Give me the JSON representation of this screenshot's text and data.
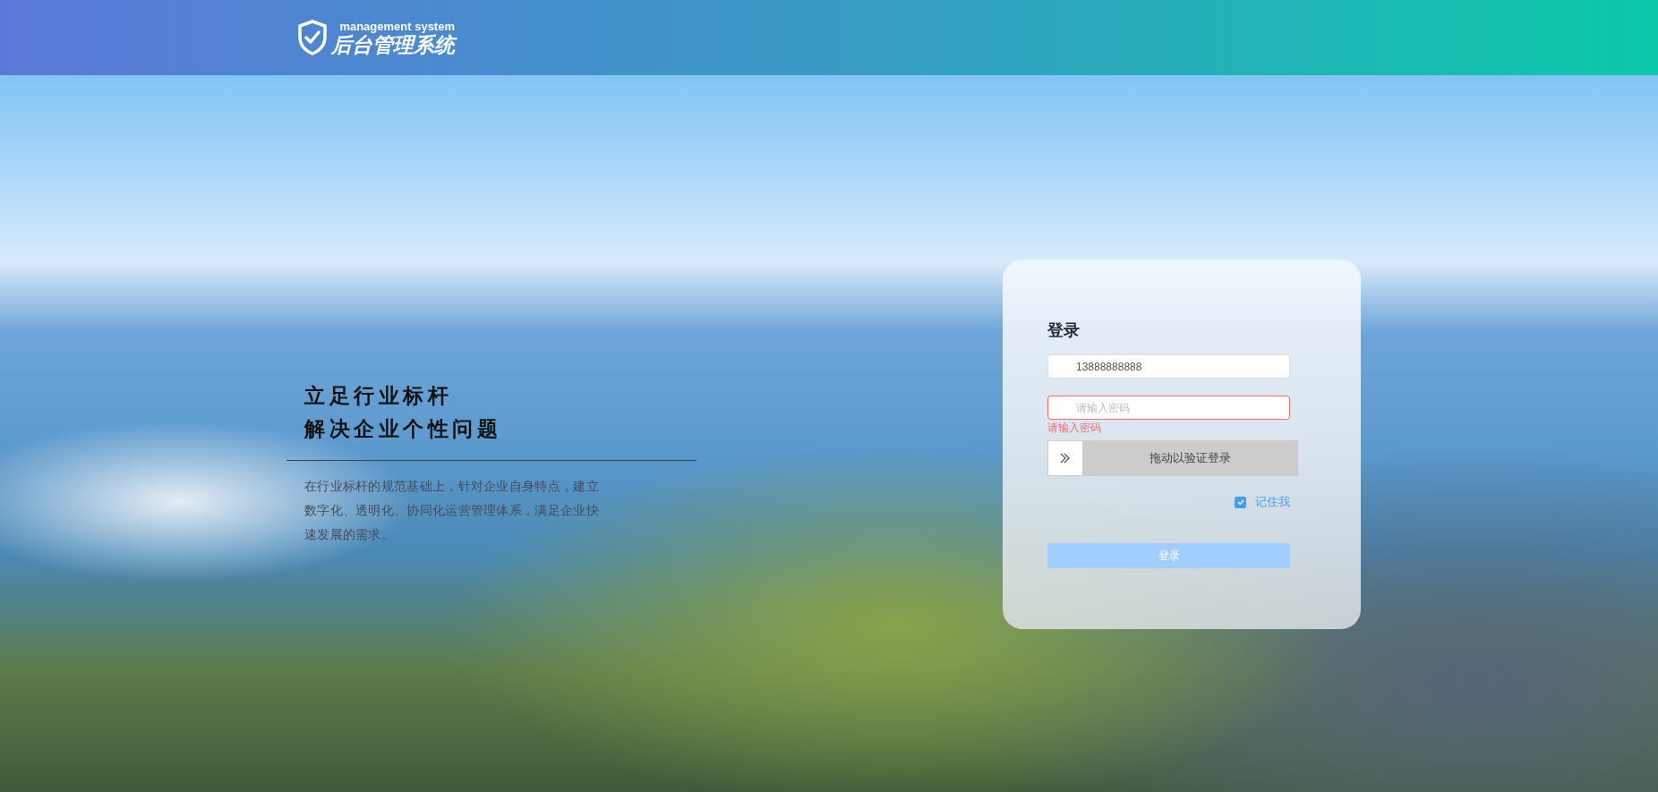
{
  "header": {
    "logo_subtitle": "management system",
    "logo_title": "后台管理系统"
  },
  "intro": {
    "headline": [
      "立足行业标杆",
      "解决企业个性问题"
    ],
    "description": "在行业标杆的规范基础上，针对企业自身特点，建立数字化、透明化、协同化运营管理体系，满足企业快速发展的需求。"
  },
  "login": {
    "title": "登录",
    "username": {
      "value": "13888888888"
    },
    "password": {
      "placeholder": "请输入密码",
      "error": "请输入密码"
    },
    "slider": {
      "label": "拖动以验证登录",
      "level": 0
    },
    "remember": {
      "label": "记住我",
      "checked": true
    },
    "submit": {
      "label": "登录",
      "disabled": true
    }
  }
}
